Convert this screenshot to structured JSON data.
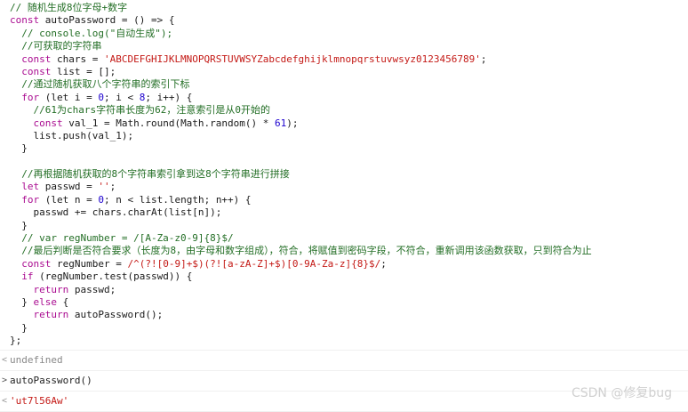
{
  "code_block": [
    [
      {
        "t": "// 随机生成8位字母+数字",
        "c": "comment"
      }
    ],
    [
      {
        "t": "const ",
        "c": "kw"
      },
      {
        "t": "autoPassword = () => {",
        "c": "plain"
      }
    ],
    [
      {
        "t": "  // console.log(\"自动生成\");",
        "c": "comment"
      }
    ],
    [
      {
        "t": "  //可获取的字符串",
        "c": "comment"
      }
    ],
    [
      {
        "t": "  const ",
        "c": "kw"
      },
      {
        "t": "chars = ",
        "c": "plain"
      },
      {
        "t": "'ABCDEFGHIJKLMNOPQRSTUVWSYZabcdefghijklmnopqrstuvwsyz0123456789'",
        "c": "str"
      },
      {
        "t": ";",
        "c": "plain"
      }
    ],
    [
      {
        "t": "  const ",
        "c": "kw"
      },
      {
        "t": "list = [];",
        "c": "plain"
      }
    ],
    [
      {
        "t": "  //通过随机获取八个字符串的索引下标",
        "c": "comment"
      }
    ],
    [
      {
        "t": "  for ",
        "c": "kw"
      },
      {
        "t": "(let i = ",
        "c": "plain"
      },
      {
        "t": "0",
        "c": "num"
      },
      {
        "t": "; i < ",
        "c": "plain"
      },
      {
        "t": "8",
        "c": "num"
      },
      {
        "t": "; i++) {",
        "c": "plain"
      }
    ],
    [
      {
        "t": "    //61为chars字符串长度为62，注意索引是从0开始的",
        "c": "comment"
      }
    ],
    [
      {
        "t": "    const ",
        "c": "kw"
      },
      {
        "t": "val_1 = Math.round(Math.random() * ",
        "c": "plain"
      },
      {
        "t": "61",
        "c": "num"
      },
      {
        "t": ");",
        "c": "plain"
      }
    ],
    [
      {
        "t": "    list.push(val_1);",
        "c": "plain"
      }
    ],
    [
      {
        "t": "  }",
        "c": "plain"
      }
    ],
    [
      {
        "t": "",
        "c": "plain"
      }
    ],
    [
      {
        "t": "  //再根据随机获取的8个字符串索引拿到这8个字符串进行拼接",
        "c": "comment"
      }
    ],
    [
      {
        "t": "  let ",
        "c": "kw"
      },
      {
        "t": "passwd = ",
        "c": "plain"
      },
      {
        "t": "''",
        "c": "str"
      },
      {
        "t": ";",
        "c": "plain"
      }
    ],
    [
      {
        "t": "  for ",
        "c": "kw"
      },
      {
        "t": "(let n = ",
        "c": "plain"
      },
      {
        "t": "0",
        "c": "num"
      },
      {
        "t": "; n < list.length; n++) {",
        "c": "plain"
      }
    ],
    [
      {
        "t": "    passwd += chars.charAt(list[n]);",
        "c": "plain"
      }
    ],
    [
      {
        "t": "  }",
        "c": "plain"
      }
    ],
    [
      {
        "t": "  // var regNumber = /[A-Za-z0-9]{8}$/",
        "c": "comment"
      }
    ],
    [
      {
        "t": "  //最后判断是否符合要求（长度为8，由字母和数字组成），符合，将赋值到密码字段，不符合，重新调用该函数获取，只到符合为止",
        "c": "comment"
      }
    ],
    [
      {
        "t": "  const ",
        "c": "kw"
      },
      {
        "t": "regNumber = ",
        "c": "plain"
      },
      {
        "t": "/^(?![0-9]+$)(?![a-zA-Z]+$)[0-9A-Za-z]{8}$/",
        "c": "str"
      },
      {
        "t": ";",
        "c": "plain"
      }
    ],
    [
      {
        "t": "  if ",
        "c": "kw"
      },
      {
        "t": "(regNumber.test(passwd)) {",
        "c": "plain"
      }
    ],
    [
      {
        "t": "    return ",
        "c": "kw"
      },
      {
        "t": "passwd;",
        "c": "plain"
      }
    ],
    [
      {
        "t": "  } ",
        "c": "plain"
      },
      {
        "t": "else ",
        "c": "kw"
      },
      {
        "t": "{",
        "c": "plain"
      }
    ],
    [
      {
        "t": "    return ",
        "c": "kw"
      },
      {
        "t": "autoPassword();",
        "c": "plain"
      }
    ],
    [
      {
        "t": "  }",
        "c": "plain"
      }
    ],
    [
      {
        "t": "};",
        "c": "plain"
      }
    ]
  ],
  "result_1": {
    "chevron": "<",
    "text": "undefined"
  },
  "input_2": {
    "chevron": ">",
    "text": "autoPassword()"
  },
  "result_2": {
    "chevron": "<",
    "text": "'ut7l56Aw'"
  },
  "watermark": "CSDN @修复bug",
  "colors": {
    "comment": "#236e25",
    "keyword": "#aa0d91",
    "string": "#c41a16",
    "number": "#1c00cf"
  }
}
